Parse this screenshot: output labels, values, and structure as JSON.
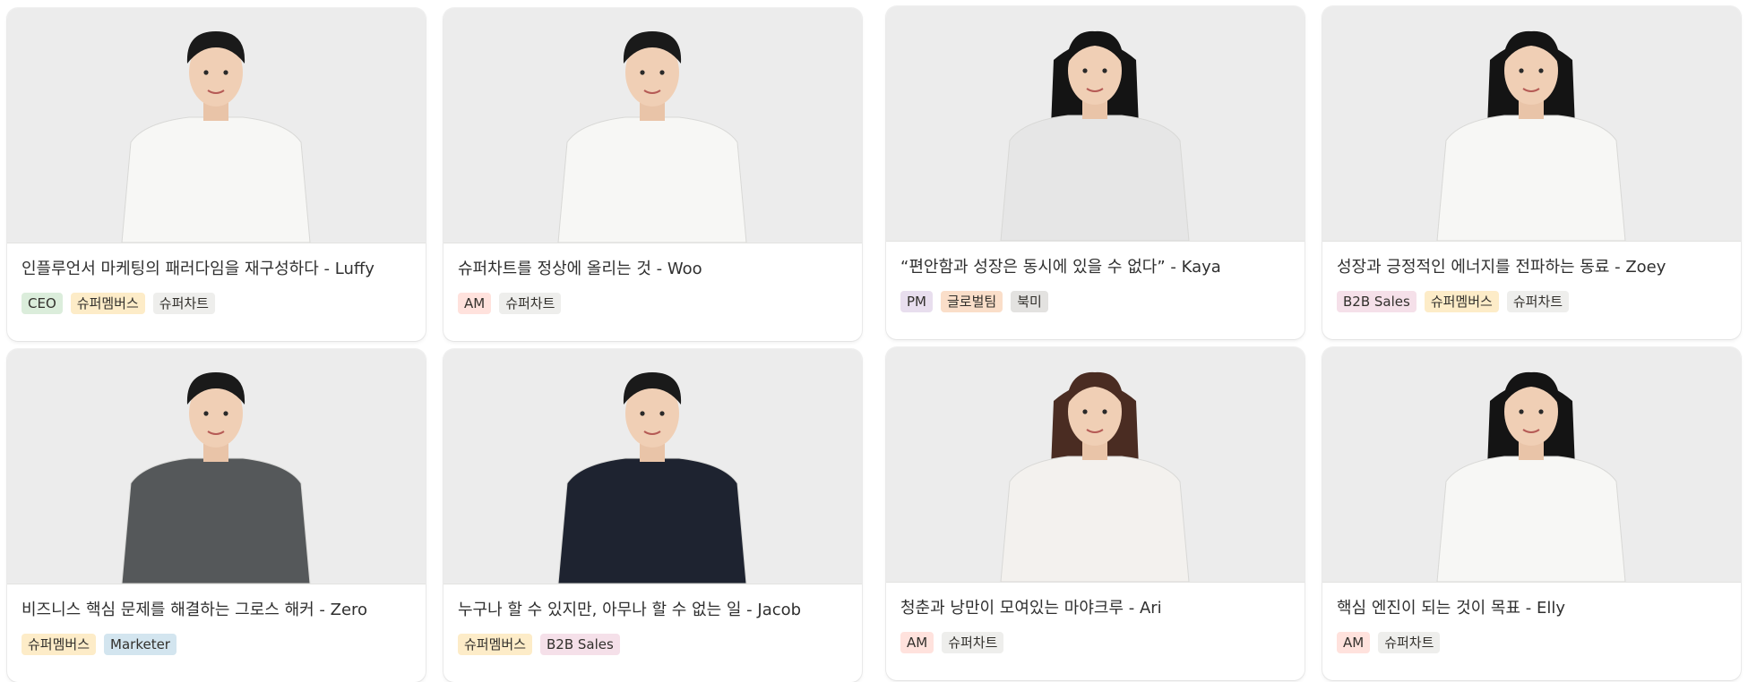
{
  "tag_colors": {
    "CEO": "#dbeddb",
    "슈퍼멤버스": "#fdecc8",
    "슈퍼차트": "#eeeeec",
    "AM": "#ffe2dd",
    "PM": "#e8deee",
    "글로벌팀": "#fadec9",
    "북미": "#e3e2e0",
    "B2B Sales": "#f5e0e9",
    "Marketer": "#d3e5ef"
  },
  "members": [
    {
      "name": "Luffy",
      "title": "인플루언서 마케팅의 패러다임을 재구성하다 - Luffy",
      "tags": [
        "CEO",
        "슈퍼멤버스",
        "슈퍼차트"
      ],
      "outfit": "white-tee",
      "hair": "short-dark"
    },
    {
      "name": "Woo",
      "title": "슈퍼차트를 정상에 올리는 것 - Woo",
      "tags": [
        "AM",
        "슈퍼차트"
      ],
      "outfit": "white-tee",
      "hair": "short-dark"
    },
    {
      "name": "Kaya",
      "title": "“편안함과 성장은 동시에 있을 수 없다”  - Kaya",
      "tags": [
        "PM",
        "글로벌팀",
        "북미"
      ],
      "outfit": "gray-print-tee",
      "hair": "long-dark"
    },
    {
      "name": "Zoey",
      "title": "성장과 긍정적인 에너지를 전파하는 동료 - Zoey",
      "tags": [
        "B2B Sales",
        "슈퍼멤버스",
        "슈퍼차트"
      ],
      "outfit": "white-tee",
      "hair": "long-dark"
    },
    {
      "name": "Zero",
      "title": "비즈니스 핵심 문제를 해결하는 그로스 해커 - Zero",
      "tags": [
        "슈퍼멤버스",
        "Marketer"
      ],
      "outfit": "gray-hoodie",
      "hair": "short-dark"
    },
    {
      "name": "Jacob",
      "title": "누구나 할 수 있지만, 아무나 할 수 없는 일 - Jacob",
      "tags": [
        "슈퍼멤버스",
        "B2B Sales"
      ],
      "outfit": "black-shirt",
      "hair": "short-dark"
    },
    {
      "name": "Ari",
      "title": "청춘과 낭만이 모여있는 마야크루 - Ari",
      "tags": [
        "AM",
        "슈퍼차트"
      ],
      "outfit": "white-lace",
      "hair": "long-brown"
    },
    {
      "name": "Elly",
      "title": "핵심 엔진이 되는 것이 목표 - Elly",
      "tags": [
        "AM",
        "슈퍼차트"
      ],
      "outfit": "white-tee",
      "hair": "long-dark"
    }
  ]
}
